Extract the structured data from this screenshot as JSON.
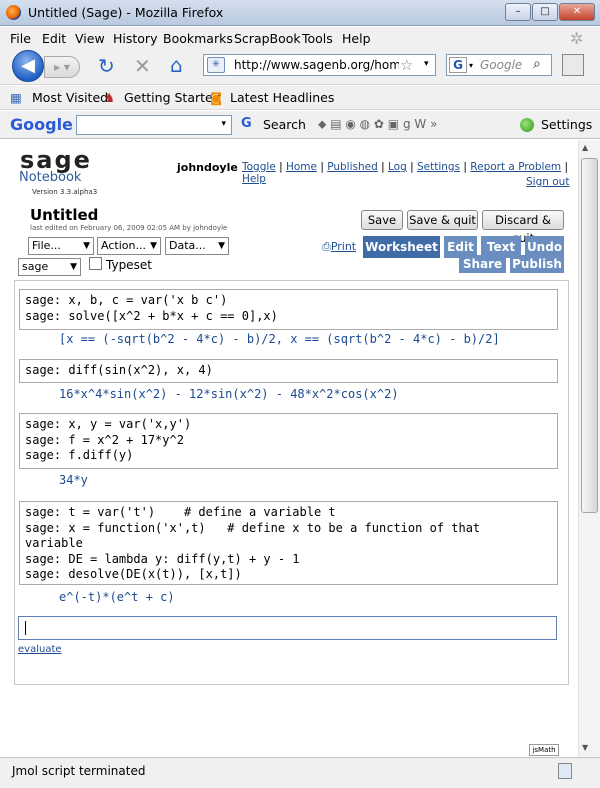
{
  "window": {
    "title": "Untitled (Sage) - Mozilla Firefox",
    "min": "–",
    "max": "□",
    "close": "✕"
  },
  "menu": [
    "File",
    "Edit",
    "View",
    "History",
    "Bookmarks",
    "ScrapBook",
    "Tools",
    "Help"
  ],
  "nav": {
    "url": "http://www.sagenb.org/home",
    "search_placeholder": "Google"
  },
  "bookmarks": [
    "Most Visited",
    "Getting Started",
    "Latest Headlines"
  ],
  "google_toolbar": {
    "logo": "Google",
    "search_label": "Search",
    "settings_label": "Settings"
  },
  "sage": {
    "logo": "sage",
    "notebook": "Notebook",
    "version": "Version 3.3.alpha3",
    "user": "johndoyle",
    "links": [
      "Toggle",
      "Home",
      "Published",
      "Log",
      "Settings",
      "Report a Problem",
      "Help"
    ],
    "sign_out": "Sign out",
    "worksheet_title": "Untitled",
    "last_edited": "last edited on February 06, 2009 02:05 AM by johndoyle",
    "buttons": {
      "save": "Save",
      "save_quit": "Save & quit",
      "discard_quit": "Discard & quit"
    },
    "selects": {
      "file": "File...",
      "action": "Action...",
      "data": "Data...",
      "system": "sage"
    },
    "typeset_label": "Typeset",
    "print_label": "Print",
    "tabs": {
      "worksheet": "Worksheet",
      "edit": "Edit",
      "text": "Text",
      "undo": "Undo",
      "share": "Share",
      "publish": "Publish"
    },
    "cells": [
      {
        "input": "sage: x, b, c = var('x b c')\nsage: solve([x^2 + b*x + c == 0],x)",
        "output": "[x == (-sqrt(b^2 - 4*c) - b)/2, x == (sqrt(b^2 - 4*c) - b)/2]"
      },
      {
        "input": "sage: diff(sin(x^2), x, 4)",
        "output": "16*x^4*sin(x^2) - 12*sin(x^2) - 48*x^2*cos(x^2)"
      },
      {
        "input": "sage: x, y = var('x,y')\nsage: f = x^2 + 17*y^2\nsage: f.diff(y)",
        "output": "34*y"
      },
      {
        "input": "sage: t = var('t')    # define a variable t\nsage: x = function('x',t)   # define x to be a function of that\nvariable\nsage: DE = lambda y: diff(y,t) + y - 1\nsage: desolve(DE(x(t)), [x,t])",
        "output": "e^(-t)*(e^t + c)"
      }
    ],
    "evaluate": "evaluate",
    "jsmath": "jsMath"
  },
  "status": "Jmol script terminated"
}
